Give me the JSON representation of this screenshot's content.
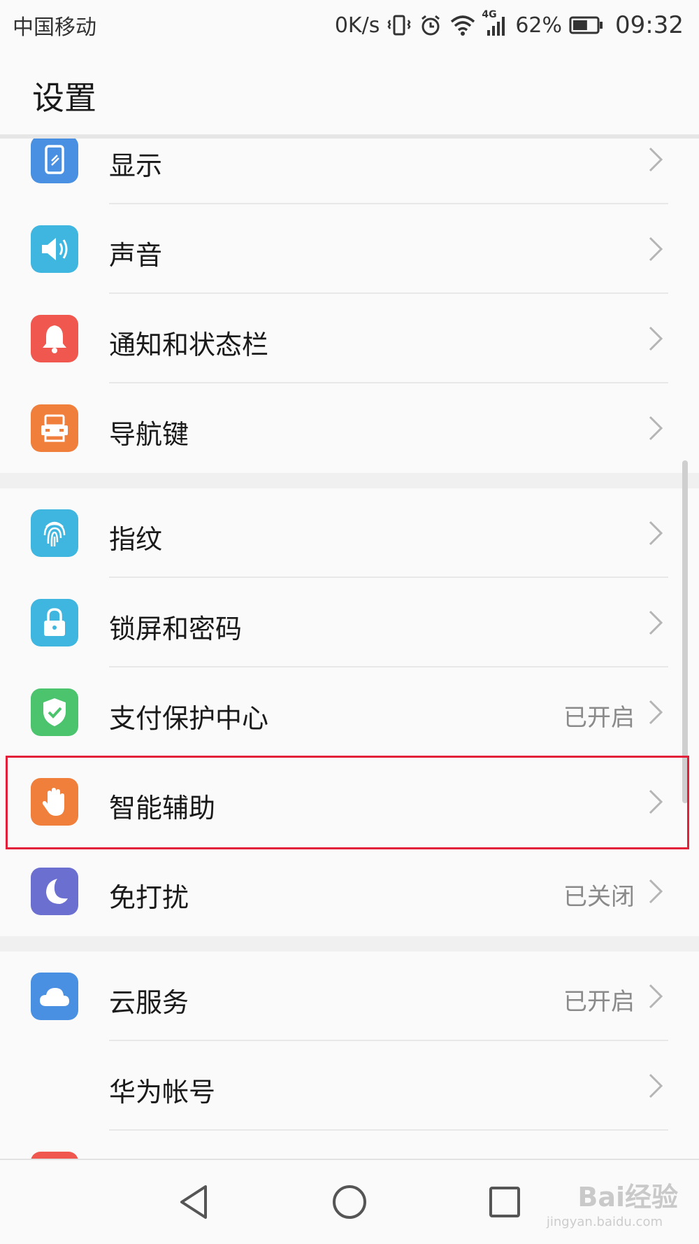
{
  "status_bar": {
    "carrier": "中国移动",
    "net_speed": "0K/s",
    "network_type": "4G",
    "battery_percent": "62%",
    "battery_level": 0.62,
    "time": "09:32",
    "icons": [
      "vibrate-icon",
      "alarm-icon",
      "wifi-icon",
      "signal-icon",
      "battery-icon"
    ]
  },
  "header": {
    "title": "设置"
  },
  "sections": [
    {
      "items": [
        {
          "label": "显示",
          "icon": "display-icon",
          "icon_color": "#4a90e2"
        },
        {
          "label": "声音",
          "icon": "sound-icon",
          "icon_color": "#3fb6e0"
        },
        {
          "label": "通知和状态栏",
          "icon": "bell-icon",
          "icon_color": "#f0584f"
        },
        {
          "label": "导航键",
          "icon": "navigation-key-icon",
          "icon_color": "#f07f3c"
        }
      ]
    },
    {
      "items": [
        {
          "label": "指纹",
          "icon": "fingerprint-icon",
          "icon_color": "#3fb6e0"
        },
        {
          "label": "锁屏和密码",
          "icon": "lock-icon",
          "icon_color": "#3fb6e0"
        },
        {
          "label": "支付保护中心",
          "icon": "shield-check-icon",
          "icon_color": "#4cc46e",
          "status": "已开启"
        },
        {
          "label": "智能辅助",
          "icon": "hand-icon",
          "icon_color": "#f07f3c",
          "highlighted": true
        },
        {
          "label": "免打扰",
          "icon": "moon-icon",
          "icon_color": "#6b6fd0",
          "status": "已关闭"
        }
      ]
    },
    {
      "items": [
        {
          "label": "云服务",
          "icon": "cloud-icon",
          "icon_color": "#4a90e2",
          "status": "已开启"
        },
        {
          "label": "华为帐号",
          "icon": ""
        }
      ]
    }
  ],
  "nav_bar": {
    "buttons": [
      "back-icon",
      "home-icon",
      "recents-icon"
    ]
  },
  "watermark": {
    "text": "Bai经验",
    "sub": "jingyan.baidu.com"
  },
  "colors": {
    "highlight": "#e3203a",
    "chevron": "#b5b5b5"
  }
}
